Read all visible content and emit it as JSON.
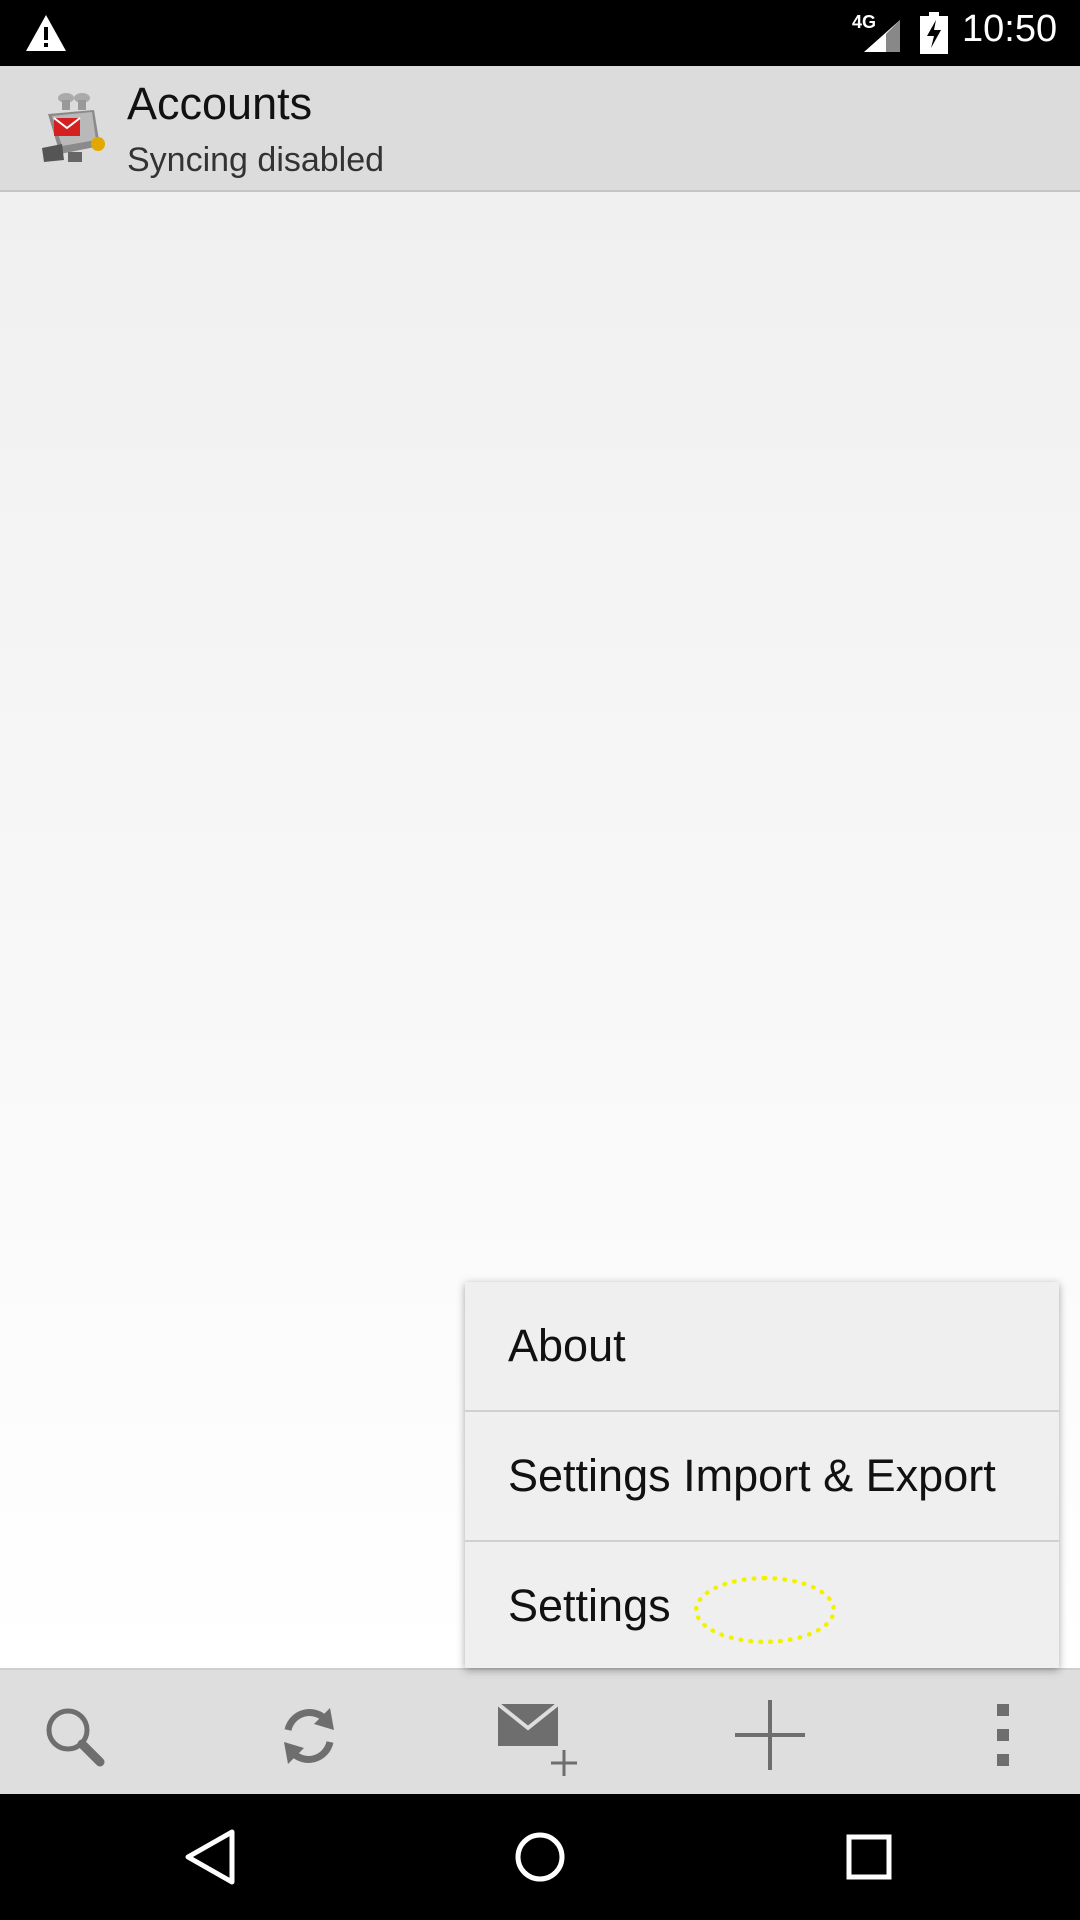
{
  "status_bar": {
    "network_label": "4G",
    "time": "10:50",
    "icons": [
      "warning-icon",
      "signal-icon",
      "battery-charging-icon"
    ]
  },
  "action_bar": {
    "title": "Accounts",
    "subtitle": "Syncing disabled",
    "logo_icon": "k9-mail-logo"
  },
  "menu": {
    "items": [
      {
        "label": "About"
      },
      {
        "label": "Settings Import & Export"
      },
      {
        "label": "Settings"
      }
    ]
  },
  "bottom_toolbar": {
    "icons": [
      "search-icon",
      "refresh-icon",
      "compose-icon",
      "add-icon",
      "overflow-menu-icon"
    ]
  },
  "nav_bar": {
    "icons": [
      "back-icon",
      "home-icon",
      "recents-icon"
    ]
  },
  "colors": {
    "action_bar_bg": "#dcdcdc",
    "toolbar_bg": "#dedede",
    "menu_bg": "#efefef",
    "tap_indicator": "#f2f200"
  }
}
